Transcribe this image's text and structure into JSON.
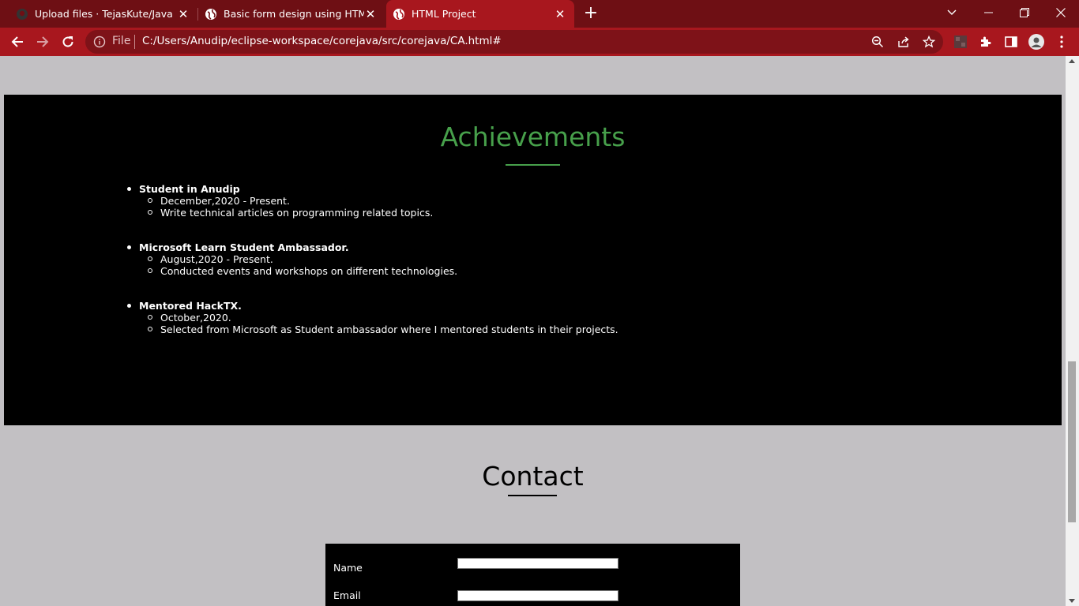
{
  "browser": {
    "tabs": [
      {
        "title": "Upload files · TejasKute/Java",
        "icon": "github-icon",
        "active": false
      },
      {
        "title": "Basic form design using HTML",
        "icon": "globe-icon",
        "active": false
      },
      {
        "title": "HTML Project",
        "icon": "globe-icon",
        "active": true
      }
    ],
    "address": {
      "scheme_label": "File",
      "url": "C:/Users/Anudip/eclipse-workspace/corejava/src/corejava/CA.html#"
    },
    "theme": {
      "frame": "#6e0f14",
      "toolbar": "#a8171e",
      "omnibox": "#7e1218"
    }
  },
  "achievements": {
    "title": "Achievements",
    "accent": "#47a04b",
    "items": [
      {
        "heading": "Student in Anudip",
        "details": [
          "December,2020 - Present.",
          "Write technical articles on programming related topics."
        ]
      },
      {
        "heading": "Microsoft Learn Student Ambassador.",
        "details": [
          "August,2020 - Present.",
          "Conducted events and workshops on different technologies."
        ]
      },
      {
        "heading": "Mentored HackTX.",
        "details": [
          "October,2020.",
          "Selected from Microsoft as Student ambassador where I mentored students in their projects."
        ]
      }
    ]
  },
  "contact": {
    "title": "Contact",
    "fields": [
      {
        "label": "Name",
        "value": ""
      },
      {
        "label": "Email",
        "value": ""
      }
    ]
  }
}
